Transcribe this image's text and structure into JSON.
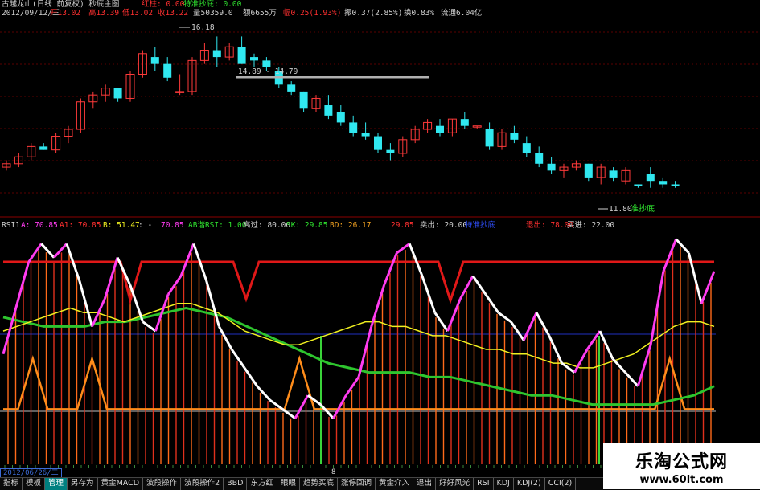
{
  "header": {
    "title": "古越龙山(日线 前复权) 秒底主图",
    "red_line_label": "红柱: 0.00",
    "bottom_label": "特准抄底: 0.00",
    "date": "2012/09/12/三",
    "open": "开13.02",
    "high": "高13.39",
    "low": "低13.02",
    "close": "收13.22",
    "volume": "量50359.0",
    "amount": "额6655万",
    "change": "幅0.25(1.93%)",
    "swing": "振0.37(2.85%)",
    "turnover": "换0.83%",
    "float": "流通6.04亿"
  },
  "price_annotations": {
    "high": "16.18",
    "range": "14.89 - 14.79",
    "low": "11.80",
    "low_signal": "准抄底"
  },
  "indicator_header": {
    "name": "RSI1",
    "a": "A: 70.85",
    "a1": "A1: 70.85",
    "b": "B: 51.47",
    "c": ": -",
    "d": "70.85",
    "ab": "AB谐RSI: 1.00",
    "overbought": "高过: 80.00",
    "sk": "SK: 29.85",
    "bd": "BD: 26.17",
    "e": "29.85",
    "sell": "卖出: 20.00",
    "f": "特准抄底",
    "exit": "退出: 78.00",
    "buy": "买进: 22.00"
  },
  "footer": {
    "date": "2012/06/26/二",
    "mid": "8"
  },
  "tabs": [
    "指标",
    "模板",
    "管理",
    "另存为",
    "黄金MACD",
    "波段操作",
    "波段操作2",
    "BBD",
    "东方红",
    "眼眼",
    "趋势买底",
    "涨停回调",
    "黄金介入",
    "退出",
    "好好风光",
    "RSI",
    "KDJ",
    "KDJ(2)",
    "CCI(2)"
  ],
  "active_tab": 2,
  "watermark": {
    "title": "乐淘公式网",
    "url": "www.60lt.com"
  },
  "colors": {
    "up_candle": "#ff3a3a",
    "down_candle": "#30e8f0",
    "magenta": "#ff3cf0",
    "yellow": "#f0f020",
    "green": "#2ec52e",
    "orange": "#ff8c1a",
    "red_line": "#e01818",
    "vline_green": "#3ad43a"
  },
  "chart_data": {
    "type": "candlestick",
    "candles": [
      [
        12.4,
        12.6,
        12.3,
        12.5
      ],
      [
        12.5,
        12.8,
        12.4,
        12.7
      ],
      [
        12.7,
        13.1,
        12.6,
        13.0
      ],
      [
        13.0,
        13.1,
        12.9,
        12.9
      ],
      [
        12.9,
        13.4,
        12.8,
        13.3
      ],
      [
        13.3,
        13.6,
        13.1,
        13.5
      ],
      [
        13.5,
        14.4,
        13.4,
        14.3
      ],
      [
        14.3,
        14.6,
        14.1,
        14.5
      ],
      [
        14.5,
        14.8,
        14.3,
        14.7
      ],
      [
        14.7,
        14.6,
        14.3,
        14.4
      ],
      [
        14.4,
        15.2,
        14.3,
        15.1
      ],
      [
        15.1,
        15.8,
        15.0,
        15.7
      ],
      [
        15.6,
        15.9,
        15.2,
        15.4
      ],
      [
        15.4,
        15.6,
        14.9,
        15.0
      ],
      [
        14.6,
        15.1,
        14.5,
        14.6
      ],
      [
        14.6,
        15.6,
        14.5,
        15.5
      ],
      [
        15.5,
        16.0,
        15.4,
        15.8
      ],
      [
        15.8,
        16.2,
        15.3,
        15.6
      ],
      [
        15.6,
        16.0,
        15.5,
        15.9
      ],
      [
        15.9,
        16.2,
        15.4,
        15.4
      ],
      [
        15.6,
        15.7,
        15.3,
        15.5
      ],
      [
        15.5,
        15.6,
        15.2,
        15.3
      ],
      [
        15.2,
        15.3,
        14.7,
        14.8
      ],
      [
        14.8,
        14.9,
        14.5,
        14.6
      ],
      [
        14.6,
        14.6,
        14.0,
        14.1
      ],
      [
        14.1,
        14.5,
        14.0,
        14.4
      ],
      [
        14.2,
        14.5,
        13.8,
        13.9
      ],
      [
        14.0,
        14.2,
        13.6,
        13.7
      ],
      [
        13.7,
        13.9,
        13.3,
        13.4
      ],
      [
        13.4,
        13.7,
        13.2,
        13.3
      ],
      [
        13.3,
        13.4,
        12.8,
        12.9
      ],
      [
        12.9,
        13.1,
        12.6,
        12.8
      ],
      [
        12.8,
        13.3,
        12.7,
        13.2
      ],
      [
        13.2,
        13.6,
        13.1,
        13.5
      ],
      [
        13.5,
        13.8,
        13.4,
        13.7
      ],
      [
        13.6,
        13.8,
        13.3,
        13.4
      ],
      [
        13.4,
        13.8,
        13.3,
        13.8
      ],
      [
        13.8,
        14.0,
        13.5,
        13.6
      ],
      [
        13.6,
        13.6,
        13.5,
        13.6
      ],
      [
        13.5,
        13.7,
        12.9,
        13.0
      ],
      [
        13.0,
        13.5,
        12.9,
        13.4
      ],
      [
        13.4,
        13.6,
        13.1,
        13.2
      ],
      [
        13.1,
        13.3,
        12.7,
        12.8
      ],
      [
        12.8,
        13.0,
        12.4,
        12.5
      ],
      [
        12.5,
        12.7,
        12.2,
        12.3
      ],
      [
        12.3,
        12.5,
        12.1,
        12.4
      ],
      [
        12.4,
        12.6,
        12.3,
        12.5
      ],
      [
        12.5,
        12.5,
        12.0,
        12.1
      ],
      [
        12.1,
        12.5,
        11.9,
        12.4
      ],
      [
        12.3,
        12.4,
        12.0,
        12.1
      ],
      [
        12.0,
        12.4,
        11.9,
        12.3
      ],
      [
        11.9,
        11.9,
        11.8,
        11.85
      ],
      [
        12.2,
        12.4,
        11.8,
        12.0
      ],
      [
        12.0,
        12.1,
        11.8,
        11.9
      ],
      [
        11.9,
        12.0,
        11.8,
        11.85
      ]
    ],
    "price_range": [
      11.0,
      16.7
    ],
    "rsi_magenta": [
      48,
      68,
      88,
      96,
      90,
      96,
      80,
      60,
      72,
      90,
      78,
      62,
      58,
      74,
      82,
      96,
      80,
      60,
      50,
      42,
      34,
      28,
      24,
      20,
      30,
      26,
      20,
      30,
      38,
      60,
      78,
      92,
      96,
      82,
      66,
      58,
      72,
      82,
      74,
      66,
      62,
      54,
      66,
      56,
      44,
      40,
      50,
      58,
      46,
      40,
      34,
      52,
      84,
      98,
      92,
      70,
      84
    ],
    "rsi_yellow": [
      58,
      60,
      62,
      64,
      66,
      68,
      66,
      66,
      64,
      62,
      64,
      66,
      68,
      70,
      70,
      68,
      66,
      62,
      58,
      56,
      54,
      52,
      52,
      54,
      56,
      58,
      60,
      62,
      62,
      60,
      60,
      58,
      56,
      56,
      54,
      52,
      50,
      50,
      48,
      48,
      46,
      44,
      44,
      42,
      42,
      44,
      46,
      48,
      52,
      56,
      60,
      62,
      62,
      60
    ],
    "rsi_green": [
      64,
      62,
      60,
      60,
      60,
      62,
      62,
      64,
      66,
      68,
      66,
      64,
      60,
      56,
      52,
      48,
      44,
      42,
      40,
      40,
      40,
      38,
      38,
      36,
      34,
      32,
      30,
      30,
      28,
      26,
      26,
      26,
      26,
      28,
      30,
      34
    ],
    "rsi_orange": [
      24,
      24,
      46,
      24,
      24,
      24,
      46,
      24,
      24,
      24,
      24,
      24,
      24,
      24,
      24,
      24,
      24,
      24,
      24,
      24,
      46,
      24,
      24,
      24,
      24,
      24,
      24,
      24,
      24,
      24,
      24,
      24,
      24,
      24,
      24,
      24,
      24,
      24,
      24,
      24,
      24,
      24,
      24,
      24,
      24,
      46,
      24,
      24,
      24
    ],
    "rsi_range": [
      0,
      100
    ]
  }
}
